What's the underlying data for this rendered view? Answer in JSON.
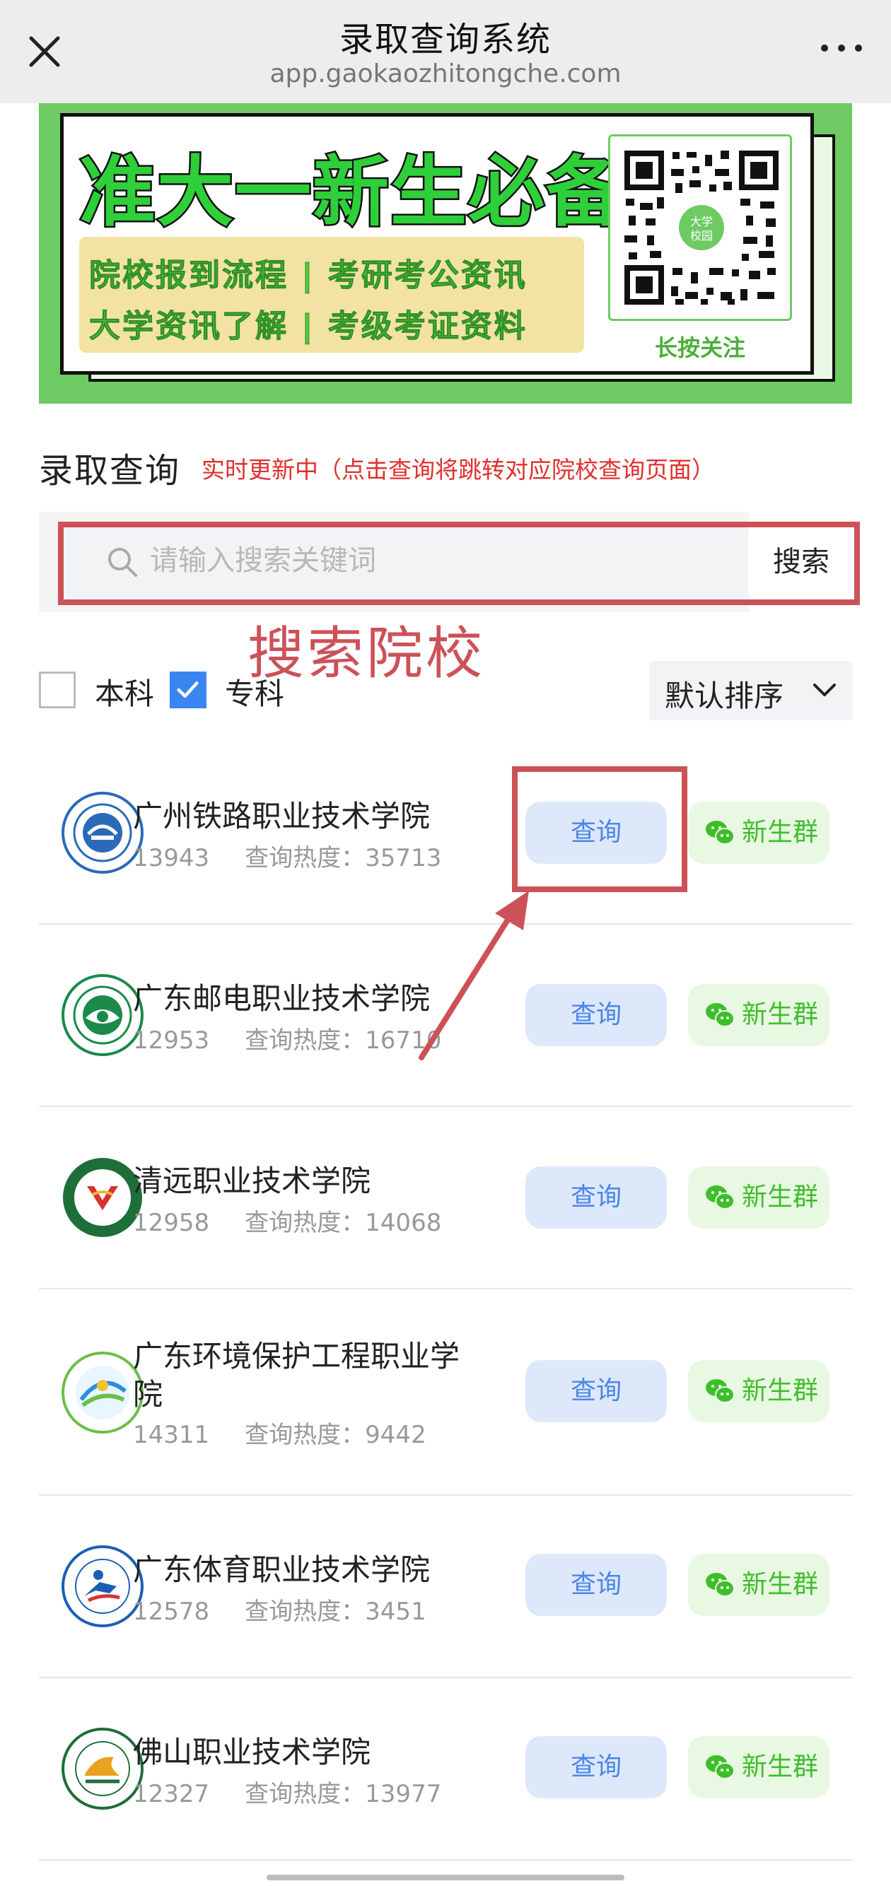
{
  "navbar": {
    "title": "录取查询系统",
    "url": "app.gaokaozhitongche.com"
  },
  "banner": {
    "headline": "准大一新生必备",
    "line1": "院校报到流程 | 考研考公资讯",
    "line2": "大学资讯了解 | 考级考证资料",
    "qr_caption": "长按关注",
    "qr_center_text": "大学校园"
  },
  "section": {
    "title": "录取查询",
    "note": "实时更新中（点击查询将跳转对应院校查询页面）"
  },
  "search": {
    "placeholder": "请输入搜索关键词",
    "value": "",
    "button_label": "搜索",
    "annotation_label": "搜索院校"
  },
  "filters": {
    "options": [
      {
        "label": "本科",
        "checked": false
      },
      {
        "label": "专科",
        "checked": true
      }
    ],
    "sort_label": "默认排序"
  },
  "list": {
    "heat_prefix": "查询热度：",
    "query_label": "查询",
    "group_label": "新生群",
    "items": [
      {
        "name": "广州铁路职业技术学院",
        "code": "13943",
        "heat": "查询热度：35713"
      },
      {
        "name": "广东邮电职业技术学院",
        "code": "12953",
        "heat": "查询热度：16710"
      },
      {
        "name": "清远职业技术学院",
        "code": "12958",
        "heat": "查询热度：14068"
      },
      {
        "name": "广东环境保护工程职业学院",
        "code": "14311",
        "heat": "查询热度：9442"
      },
      {
        "name": "广东体育职业技术学院",
        "code": "12578",
        "heat": "查询热度：3451"
      },
      {
        "name": "佛山职业技术学院",
        "code": "12327",
        "heat": "查询热度：13977"
      }
    ]
  },
  "colors": {
    "annotation_red": "#cc5258",
    "banner_green": "#6ecb63",
    "query_blue": "#4a86e8",
    "group_green": "#3fbe2c",
    "note_red": "#e02f2f"
  }
}
